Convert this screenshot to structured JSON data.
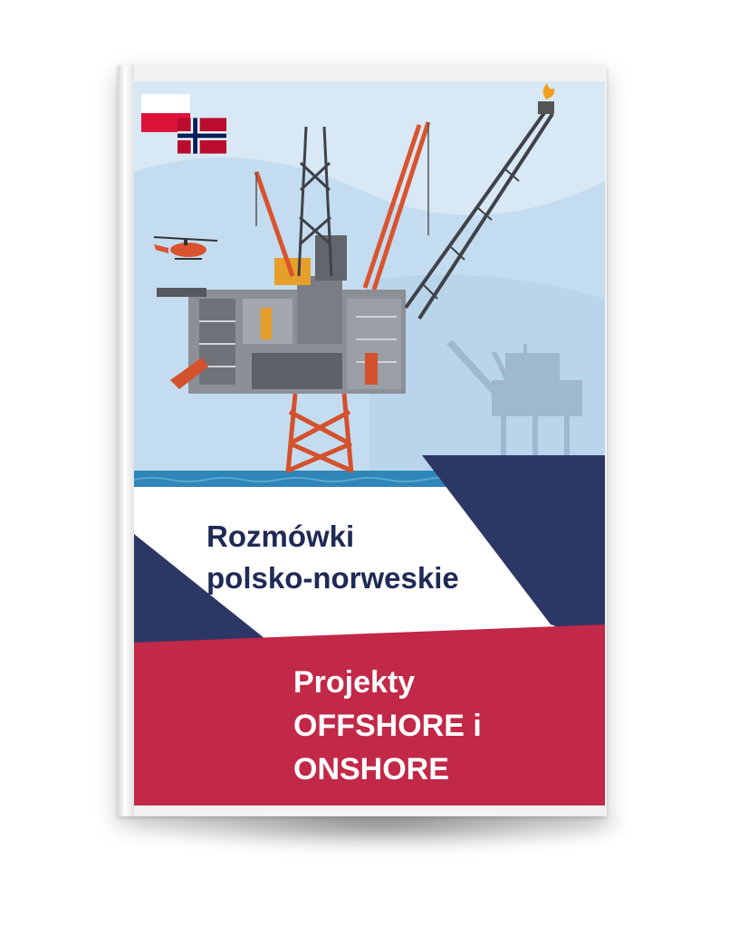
{
  "cover": {
    "title_lines": [
      "Rozmówki",
      "polsko-norweskie"
    ],
    "subtitle_lines": [
      "Projekty",
      "OFFSHORE i",
      "ONSHORE"
    ]
  },
  "flags": [
    "poland-flag",
    "norway-flag"
  ],
  "colors": {
    "sky": "#d7e8f5",
    "sea": "#2f86b8",
    "navy": "#2d3766",
    "crimson": "#c22847",
    "rig_red": "#d9532f",
    "title_text": "#1f2a55"
  }
}
